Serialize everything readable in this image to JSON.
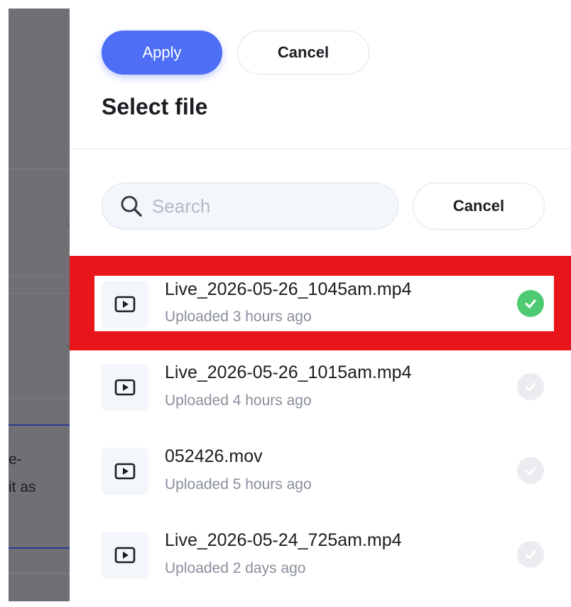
{
  "background": {
    "fragments": [
      "e-",
      "it as"
    ]
  },
  "panel": {
    "apply_label": "Apply",
    "cancel_label": "Cancel",
    "title": "Select file",
    "search": {
      "placeholder": "Search",
      "value": ""
    },
    "search_cancel_label": "Cancel"
  },
  "files": [
    {
      "name": "Live_2026-05-26_1045am.mp4",
      "meta": "Uploaded 3 hours ago",
      "selected": true
    },
    {
      "name": "Live_2026-05-26_1015am.mp4",
      "meta": "Uploaded 4 hours ago",
      "selected": false
    },
    {
      "name": "052426.mov",
      "meta": "Uploaded 5 hours ago",
      "selected": false
    },
    {
      "name": "Live_2026-05-24_725am.mp4",
      "meta": "Uploaded 2 days ago",
      "selected": false
    }
  ],
  "colors": {
    "accent": "#4d6ef5",
    "check_on": "#4ecb72",
    "highlight": "#e8161a"
  }
}
